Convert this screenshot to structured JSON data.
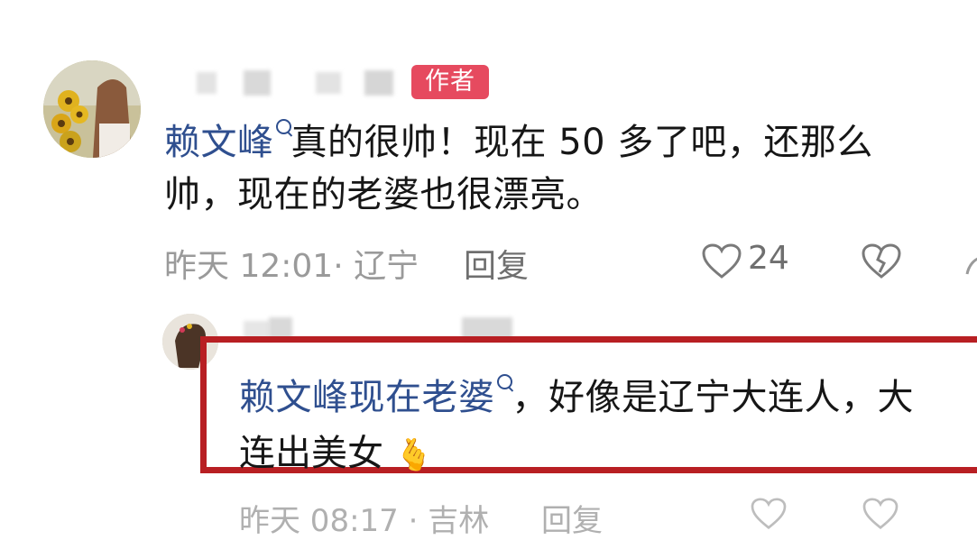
{
  "comment": {
    "author_badge": "作者",
    "mention": "赖文峰",
    "text_line1": "真的很帅！现在 50 多了吧，还那么",
    "text_line2": "帅，现在的老婆也很漂亮。",
    "meta": "昨天 12:01· 辽宁",
    "reply_label": "回复",
    "likes": "24"
  },
  "reply": {
    "mention": "赖文峰现在老婆",
    "text_line1": "，好像是辽宁大连人，大",
    "text_line2": "连出美女",
    "emoji": "🫰",
    "meta_partial": "昨天 08:17 · 吉林",
    "reply_label": "回复"
  },
  "colors": {
    "mention": "#2f4f8f",
    "badge": "#e64a5f",
    "highlight": "#b81f23"
  }
}
